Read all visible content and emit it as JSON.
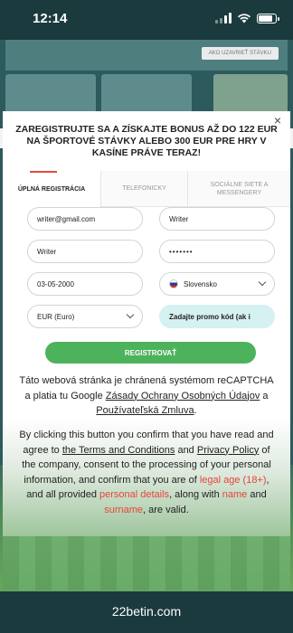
{
  "status_bar": {
    "time": "12:14"
  },
  "background": {
    "promo_button": "AKO UZAVRIEŤ STÁVKU"
  },
  "modal": {
    "close": "×",
    "title": "ZAREGISTRUJTE SA A ZÍSKAJTE BONUS AŽ DO 122 EUR NA ŠPORTOVÉ STÁVKY ALEBO 300 EUR PRE HRY V KASÍNE PRÁVE TERAZ!",
    "tabs": [
      "ÚPLNÁ REGISTRÁCIA",
      "TELEFONICKY",
      "SOCIÁLNE SIETE A MESSENGERY"
    ],
    "fields": {
      "email": "writer@gmail.com",
      "first_name": "Writer",
      "last_name": "Writer",
      "password": "•••••••",
      "dob": "03-05-2000",
      "country": "Slovensko",
      "currency": "EUR (Euro)",
      "promo_placeholder": "Zadajte promo kód (ak i"
    },
    "register_label": "REGISTROVAŤ",
    "recaptcha": {
      "prefix": "Táto webová stránka je chránená systémom reCAPTCHA a platia tu Google ",
      "privacy": "Zásady Ochrany Osobných Údajov",
      "and": " a ",
      "terms": "Používateľská Zmluva",
      "end": "."
    },
    "consent": {
      "p1": "By clicking this button you confirm that you have read and agree to ",
      "terms": "the Terms and Conditions",
      "p2": " and ",
      "privacy": "Privacy Policy",
      "p3": " of the company, consent to the processing of your personal information, and confirm that you are of ",
      "legal_age": "legal age (18+)",
      "p4": ", and all provided ",
      "personal_details": "personal details",
      "p5": ", along with ",
      "name": "name",
      "p6": " and ",
      "surname": "surname",
      "p7": ", are valid."
    }
  },
  "browser": {
    "url": "22betin.com"
  },
  "colors": {
    "accent_green": "#4db25c",
    "tab_accent": "#e64a3b",
    "promo_bg": "#d5f1f1",
    "dark_teal": "#1b3a3d"
  }
}
